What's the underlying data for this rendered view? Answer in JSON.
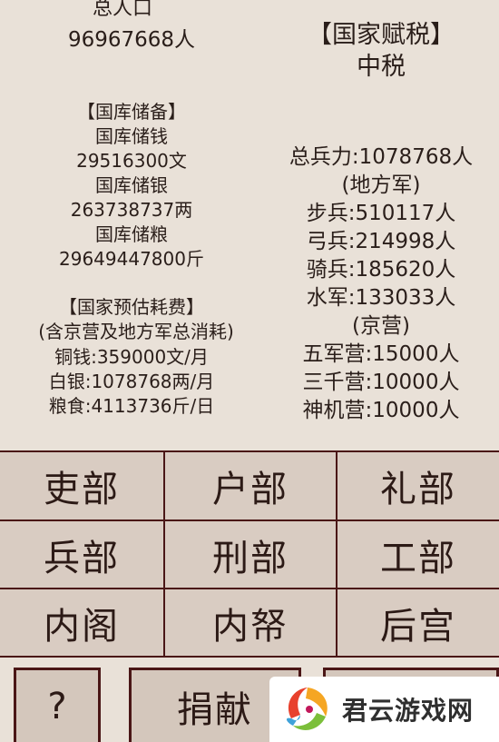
{
  "left_stats": {
    "population_label": "总人口",
    "population_value": "96967668人",
    "treasury_header": "【国库储备】",
    "copper_label": "国库储钱",
    "copper_value": "29516300文",
    "silver_label": "国库储银",
    "silver_value": "263738737两",
    "grain_label": "国库储粮",
    "grain_value": "29649447800斤",
    "expense_header": "【国家预估耗费】",
    "expense_note": "(含京营及地方军总消耗)",
    "expense_copper": "铜钱:359000文/月",
    "expense_silver": "白银:1078768两/月",
    "expense_grain": "粮食:4113736斤/日"
  },
  "right_stats": {
    "tax_header": "【国家赋税】",
    "tax_value": "中税",
    "total_troops": "总兵力:1078768人",
    "local_army_header": "(地方军)",
    "infantry": "步兵:510117人",
    "archers": "弓兵:214998人",
    "cavalry": "骑兵:185620人",
    "navy": "水军:133033人",
    "capital_army_header": "(京营)",
    "wujunying": "五军营:15000人",
    "sanqianying": "三千营:10000人",
    "shenjiying": "神机营:10000人"
  },
  "departments": [
    "吏部",
    "户部",
    "礼部",
    "兵部",
    "刑部",
    "工部",
    "内阁",
    "内帑",
    "后宫"
  ],
  "bottom": {
    "help_label": "?",
    "donate_label": "捐献"
  },
  "watermark": {
    "text": "君云游戏网",
    "logo_icon": "swirl-logo-icon"
  },
  "colors": {
    "background": "#e9e1d8",
    "button_bg": "#d4c7bc",
    "border": "#4a1616"
  }
}
